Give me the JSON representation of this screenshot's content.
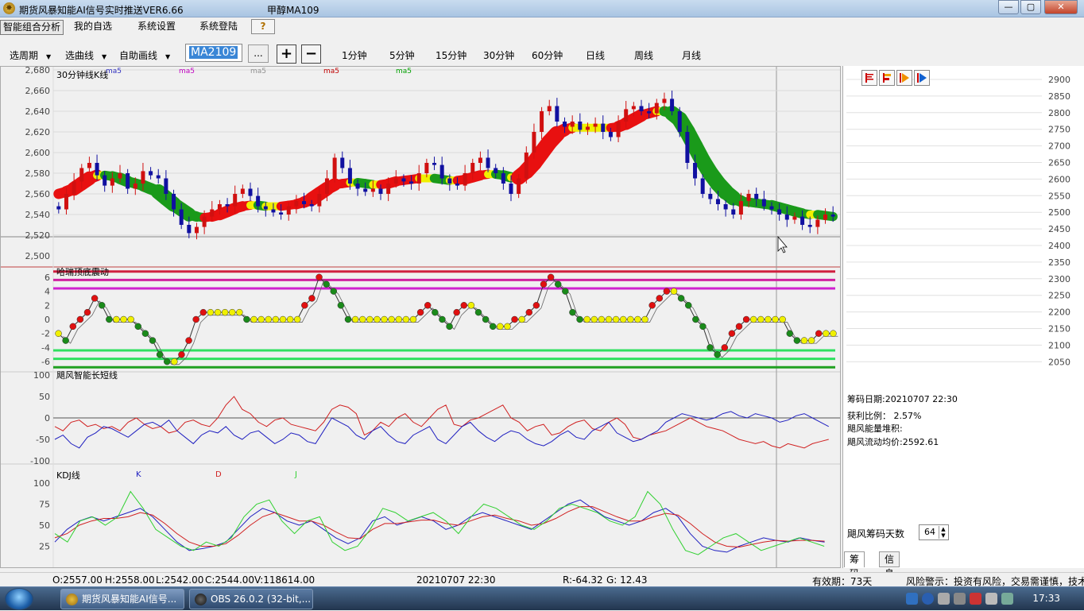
{
  "window": {
    "title": "期货风暴知能AI信号实时推送VER6.66",
    "contract_title": "甲醇MA109",
    "min_label": "—",
    "max_label": "▢",
    "close_label": "✕"
  },
  "menu": {
    "items": [
      "智能组合分析",
      "我的自选",
      "系统设置",
      "系统登陆"
    ],
    "help_label": "?"
  },
  "toolbar": {
    "period_select": "选周期",
    "curve_select": "选曲线",
    "draw_select": "自助画线",
    "contract_code": "MA2109",
    "more_label": "...",
    "plus_label": "+",
    "minus_label": "−",
    "periods": [
      "1分钟",
      "5分钟",
      "15分钟",
      "30分钟",
      "60分钟",
      "日线",
      "周线",
      "月线"
    ]
  },
  "kline_panel": {
    "title": "30分钟线K线",
    "ma_labels": [
      "ma5",
      "ma5",
      "ma5",
      "ma5",
      "ma5"
    ],
    "ma_colors": [
      "#3030c0",
      "#c000c0",
      "#909090",
      "#c00000",
      "#00a000"
    ],
    "y_ticks": [
      "2,680",
      "2,660",
      "2,640",
      "2,620",
      "2,600",
      "2,580",
      "2,560",
      "2,540",
      "2,520",
      "2,500"
    ]
  },
  "osc_panel": {
    "title": "哈瑞顶底震动",
    "y_ticks": [
      "6",
      "4",
      "2",
      "0",
      "-2",
      "-4",
      "-6"
    ]
  },
  "trend_panel": {
    "title": "飓风智能长短线",
    "y_ticks": [
      "100",
      "50",
      "0",
      "-50",
      "-100"
    ]
  },
  "kdj_panel": {
    "title": "KDJ线",
    "k_label": "K",
    "d_label": "D",
    "j_label": "J",
    "colors": {
      "k": "#2020c0",
      "d": "#d02020",
      "j": "#30d030"
    },
    "y_ticks": [
      "100",
      "75",
      "50",
      "25"
    ]
  },
  "chip_panel": {
    "price_ticks": [
      "2900",
      "2850",
      "2800",
      "2750",
      "2700",
      "2650",
      "2600",
      "2550",
      "2500",
      "2450",
      "2400",
      "2350",
      "2300",
      "2250",
      "2200",
      "2150",
      "2100",
      "2050"
    ],
    "chip_date": "筹码日期:20210707 22:30",
    "profit_ratio": "获利比例：  2.57%",
    "energy": "飓风能量堆积:",
    "avg_cost": "飓风流动均价:2592.61",
    "days_label": "飓风筹码天数",
    "days_value": "64",
    "tab_chip": "筹码",
    "tab_info": "信息"
  },
  "chart_data": [
    {
      "type": "candlestick",
      "title": "30分钟线K线",
      "ylim": [
        2500,
        2680
      ],
      "closes": [
        2545,
        2560,
        2572,
        2585,
        2590,
        2578,
        2568,
        2575,
        2580,
        2565,
        2570,
        2582,
        2578,
        2575,
        2560,
        2545,
        2530,
        2522,
        2528,
        2538,
        2545,
        2550,
        2548,
        2560,
        2565,
        2558,
        2548,
        2545,
        2542,
        2540,
        2548,
        2553,
        2550,
        2548,
        2560,
        2575,
        2595,
        2585,
        2570,
        2565,
        2562,
        2565,
        2560,
        2570,
        2575,
        2572,
        2570,
        2580,
        2590,
        2588,
        2575,
        2570,
        2568,
        2580,
        2590,
        2595,
        2585,
        2580,
        2570,
        2560,
        2575,
        2600,
        2620,
        2640,
        2645,
        2630,
        2625,
        2630,
        2622,
        2625,
        2628,
        2620,
        2615,
        2630,
        2642,
        2645,
        2640,
        2638,
        2648,
        2652,
        2640,
        2620,
        2590,
        2575,
        2560,
        2555,
        2550,
        2545,
        2540,
        2553,
        2560,
        2555,
        2548,
        2545,
        2540,
        2535,
        2538,
        2530,
        2528,
        2535,
        2540,
        2538
      ],
      "series": [
        {
          "name": "MA",
          "values": [
            2560,
            2562,
            2565,
            2570,
            2575,
            2578,
            2578,
            2577,
            2575,
            2572,
            2570,
            2568,
            2565,
            2562,
            2556,
            2550,
            2545,
            2540,
            2538,
            2537,
            2538,
            2540,
            2543,
            2546,
            2548,
            2549,
            2549,
            2548,
            2548,
            2548,
            2549,
            2550,
            2552,
            2555,
            2560,
            2565,
            2569,
            2570,
            2571,
            2571,
            2570,
            2569,
            2569,
            2570,
            2572,
            2573,
            2574,
            2575,
            2575,
            2575,
            2574,
            2573,
            2573,
            2574,
            2576,
            2578,
            2579,
            2579,
            2578,
            2576,
            2576,
            2582,
            2590,
            2600,
            2610,
            2618,
            2622,
            2624,
            2624,
            2624,
            2624,
            2624,
            2624,
            2625,
            2628,
            2632,
            2636,
            2638,
            2640,
            2640,
            2638,
            2632,
            2620,
            2606,
            2592,
            2580,
            2570,
            2562,
            2556,
            2553,
            2552,
            2551,
            2550,
            2549,
            2547,
            2545,
            2543,
            2541,
            2540,
            2540,
            2539,
            2538
          ]
        }
      ]
    },
    {
      "type": "line",
      "title": "哈瑞顶底震动",
      "ylim": [
        -7,
        7
      ],
      "series": [
        {
          "name": "",
          "values": [
            -2,
            -3,
            -1,
            0,
            1,
            3,
            2,
            0,
            0,
            0,
            0,
            -1,
            -2,
            -3,
            -5,
            -6,
            -6,
            -5,
            -3,
            0,
            1,
            1,
            1,
            1,
            1,
            1,
            0,
            0,
            0,
            0,
            0,
            0,
            0,
            0,
            2,
            3,
            6,
            5,
            4,
            2,
            0,
            0,
            0,
            0,
            0,
            0,
            0,
            0,
            0,
            0,
            1,
            2,
            1,
            0,
            -1,
            1,
            2,
            2,
            1,
            0,
            -1,
            -1,
            -1,
            0,
            0,
            1,
            2,
            5,
            6,
            5,
            4,
            1,
            0,
            0,
            0,
            0,
            0,
            0,
            0,
            0,
            0,
            0,
            2,
            3,
            4,
            4,
            3,
            2,
            0,
            -1,
            -4,
            -5,
            -4,
            -2,
            -1,
            0,
            0,
            0,
            0,
            0,
            0,
            -2,
            -3,
            -3,
            -3,
            -2,
            -2,
            -2
          ]
        }
      ]
    },
    {
      "type": "line",
      "title": "飓风智能长短线",
      "ylim": [
        -100,
        100
      ],
      "series": [
        {
          "name": "",
          "values": [
            -20,
            -30,
            -10,
            -5,
            -20,
            -15,
            -25,
            -20,
            -30,
            -10,
            0,
            -15,
            -25,
            -20,
            -35,
            -30,
            -10,
            -5,
            -15,
            -20,
            0,
            30,
            50,
            20,
            10,
            -10,
            -20,
            -5,
            0,
            -15,
            -20,
            -25,
            -30,
            -10,
            20,
            30,
            25,
            10,
            -40,
            -30,
            -10,
            -20,
            0,
            10,
            -10,
            -20,
            0,
            20,
            30,
            -15,
            -20,
            -5,
            0,
            10,
            20,
            30,
            0,
            -10,
            -30,
            -20,
            -15,
            -40,
            -35,
            -20,
            -10,
            -5,
            -25,
            -30,
            -10,
            0,
            -15,
            -45,
            -50,
            -40,
            -35,
            -30,
            -20,
            -10,
            0,
            -10,
            -20,
            -25,
            -30,
            -40,
            -50,
            -55,
            -60,
            -55,
            -65,
            -70,
            -60,
            -65,
            -70,
            -60,
            -55,
            -50
          ]
        },
        {
          "name": "",
          "values": [
            -50,
            -40,
            -60,
            -70,
            -45,
            -35,
            -20,
            -25,
            -35,
            -45,
            -30,
            -15,
            -10,
            -20,
            -5,
            -30,
            -45,
            -60,
            -40,
            -30,
            -35,
            -20,
            -40,
            -50,
            -35,
            -30,
            -45,
            -60,
            -50,
            -35,
            -40,
            -55,
            -60,
            -30,
            0,
            -10,
            -20,
            -40,
            -50,
            -30,
            -20,
            -40,
            -55,
            -60,
            -40,
            -30,
            -20,
            -50,
            -60,
            -40,
            -20,
            -10,
            -30,
            -45,
            -55,
            -40,
            -30,
            -35,
            -50,
            -60,
            -65,
            -55,
            -40,
            -30,
            -45,
            -50,
            -30,
            -20,
            -10,
            -35,
            -45,
            -55,
            -50,
            -40,
            -30,
            -10,
            0,
            10,
            5,
            0,
            -5,
            0,
            10,
            15,
            5,
            0,
            10,
            5,
            0,
            -10,
            -5,
            5,
            10,
            0,
            -10,
            -20
          ]
        }
      ]
    },
    {
      "type": "line",
      "title": "KDJ线",
      "ylim": [
        0,
        100
      ],
      "series": [
        {
          "name": "K",
          "values": [
            30,
            45,
            55,
            60,
            55,
            60,
            65,
            70,
            60,
            45,
            30,
            20,
            22,
            25,
            30,
            45,
            60,
            70,
            65,
            55,
            50,
            55,
            45,
            35,
            28,
            35,
            55,
            60,
            50,
            55,
            60,
            55,
            45,
            50,
            60,
            65,
            60,
            55,
            50,
            45,
            55,
            65,
            75,
            80,
            70,
            60,
            55,
            50,
            55,
            65,
            70,
            60,
            40,
            25,
            20,
            18,
            25,
            30,
            35,
            32,
            30,
            35,
            32,
            30
          ]
        },
        {
          "name": "D",
          "values": [
            35,
            40,
            50,
            55,
            58,
            58,
            60,
            65,
            62,
            52,
            40,
            30,
            25,
            25,
            28,
            38,
            50,
            60,
            65,
            60,
            55,
            55,
            50,
            42,
            35,
            34,
            45,
            52,
            52,
            54,
            56,
            56,
            52,
            50,
            55,
            60,
            62,
            58,
            55,
            50,
            52,
            58,
            66,
            72,
            72,
            66,
            60,
            55,
            55,
            60,
            64,
            62,
            52,
            40,
            30,
            25,
            24,
            27,
            30,
            32,
            31,
            32,
            32,
            31
          ]
        },
        {
          "name": "J",
          "values": [
            40,
            30,
            55,
            60,
            50,
            60,
            90,
            70,
            45,
            35,
            25,
            20,
            30,
            25,
            35,
            60,
            75,
            80,
            55,
            40,
            55,
            60,
            30,
            20,
            25,
            45,
            70,
            65,
            55,
            60,
            65,
            55,
            40,
            60,
            75,
            70,
            60,
            50,
            45,
            55,
            70,
            75,
            70,
            65,
            55,
            50,
            60,
            90,
            75,
            45,
            20,
            15,
            25,
            35,
            40,
            30,
            20,
            25,
            30,
            35,
            30,
            25
          ]
        }
      ]
    }
  ],
  "status": {
    "open": "O:2557.00",
    "high": "H:2558.00",
    "low": "L:2542.00",
    "close": "C:2544.00",
    "volume": "V:118614.00",
    "datetime": "20210707 22:30",
    "r_value": "R:-64.32",
    "g_value": "G: 12.43",
    "validity": "有效期：73天",
    "warning": "风险警示：投资有风险，交易需谨慎，技术"
  },
  "taskbar": {
    "app1": "期货风暴知能AI信号...",
    "app2": "OBS 26.0.2 (32-bit,...",
    "clock": "17:33"
  }
}
